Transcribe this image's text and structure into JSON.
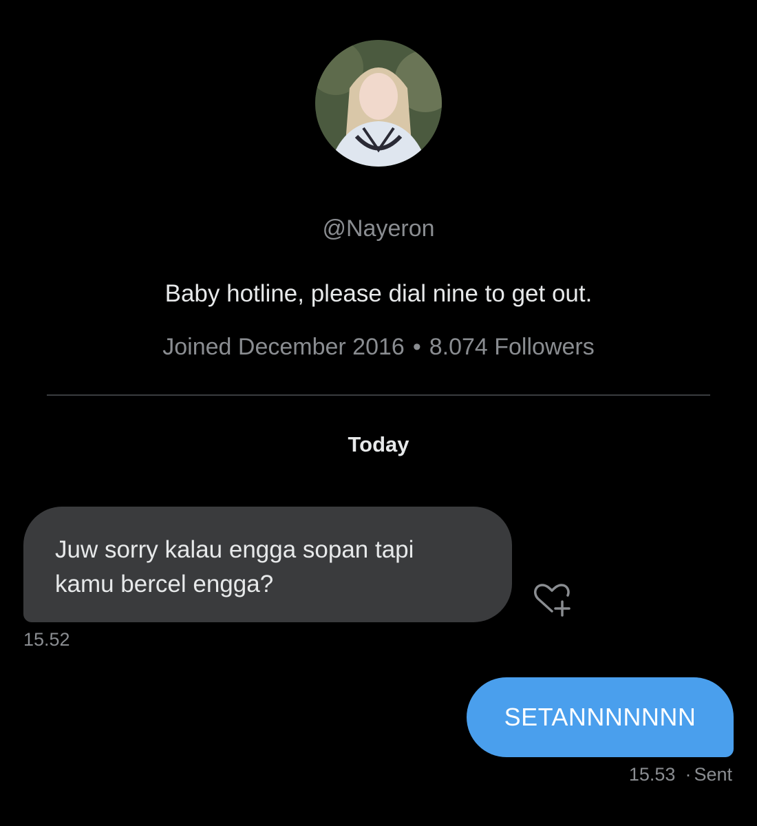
{
  "profile": {
    "handle": "@Nayeron",
    "bio": "Baby hotline, please dial nine to get out.",
    "joined": "Joined December 2016",
    "separator": "•",
    "followers": "8.074 Followers"
  },
  "conversation": {
    "day_label": "Today",
    "messages": [
      {
        "direction": "incoming",
        "text": "Juw sorry kalau engga sopan tapi\nkamu bercel engga?",
        "time": "15.52",
        "icon": "heart-plus-icon"
      },
      {
        "direction": "outgoing",
        "text": "SETANNNNNNN",
        "time": "15.53",
        "separator": "·",
        "status": "Sent"
      }
    ]
  },
  "colors": {
    "background": "#000000",
    "incoming_bubble": "#3a3b3d",
    "outgoing_bubble": "#4a9fed",
    "muted_text": "#8a8d91",
    "divider": "#3a3d40"
  }
}
